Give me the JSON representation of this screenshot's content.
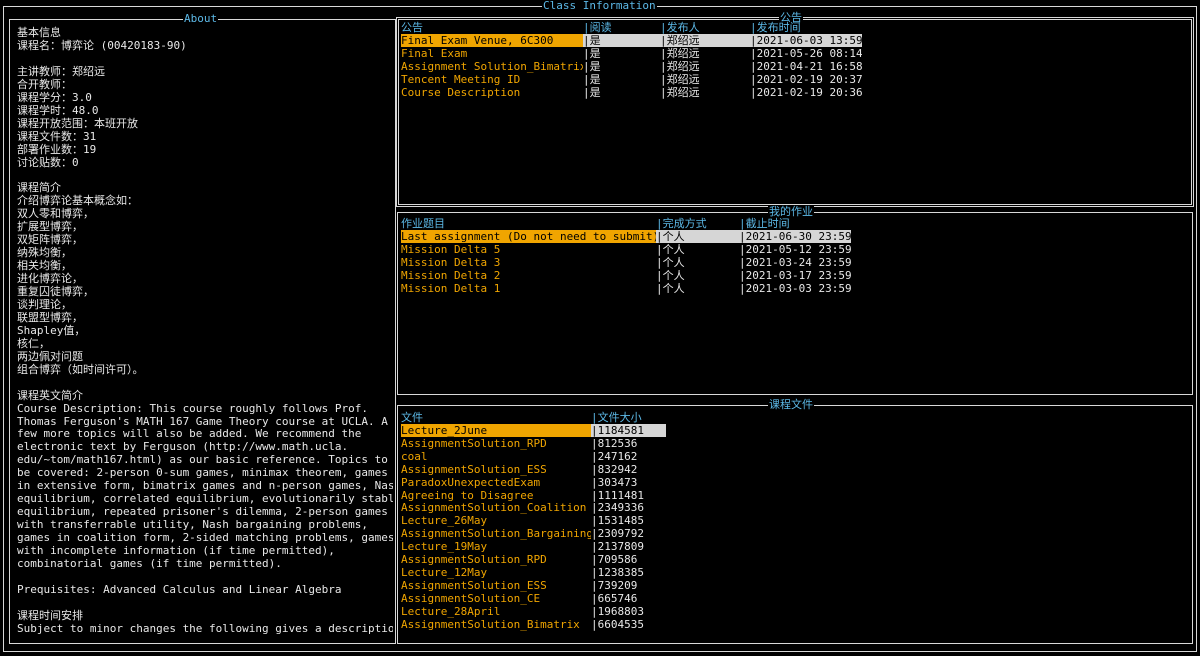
{
  "window_title": "Class Information",
  "about": {
    "title": "About",
    "lines": [
      "基本信息",
      "课程名：博弈论 (00420183-90)",
      "",
      "主讲教师：郑绍远",
      "合开教师：",
      "课程学分：3.0",
      "课程学时：48.0",
      "课程开放范围：本班开放",
      "课程文件数：31",
      "部署作业数：19",
      "讨论贴数：0",
      "",
      "课程简介",
      "介绍博弈论基本概念如：",
      "双人零和博弈，",
      "扩展型博弈，",
      "双矩阵博弈，",
      "纳殊均衡，",
      "相关均衡，",
      "进化博弈论，",
      "重复囚徒博弈，",
      "谈判理论，",
      "联盟型博弈，",
      "Shapley值，",
      "核仁，",
      "两边佩对问题",
      "组合博弈（如时间许可）。",
      "",
      "课程英文简介",
      "Course Description: This course roughly follows Prof.",
      "Thomas Ferguson's MATH 167 Game Theory course at UCLA. A",
      "few more topics will also be added. We recommend the",
      "electronic text by Ferguson (http://www.math.ucla.",
      "edu/~tom/math167.html) as our basic reference. Topics to",
      "be covered: 2-person 0-sum games, minimax theorem, games",
      "in extensive form, bimatrix games and n-person games, Nash",
      "equilibrium, correlated equilibrium, evolutionarily stable",
      "equilibrium, repeated prisoner's dilemma, 2-person games",
      "with transferrable utility, Nash bargaining problems,",
      "games in coalition form, 2-sided matching problems, games",
      "with incomplete information (if time permitted),",
      "combinatorial games (if time permitted).",
      "",
      "Prequisites: Advanced Calculus and Linear Algebra",
      "",
      "课程时间安排",
      "Subject to minor changes the following gives a description"
    ]
  },
  "announcements": {
    "title": "公告",
    "headers": [
      "公告",
      "|阅读",
      "|发布人",
      "|发布时间"
    ],
    "rows": [
      {
        "title": "Final Exam Venue, 6C300",
        "read": "|是",
        "author": "|郑绍远",
        "time": "|2021-06-03 13:59"
      },
      {
        "title": "Final Exam",
        "read": "|是",
        "author": "|郑绍远",
        "time": "|2021-05-26 08:14"
      },
      {
        "title": "Assignment Solution_Bimatrix",
        "read": "|是",
        "author": "|郑绍远",
        "time": "|2021-04-21 16:58"
      },
      {
        "title": "Tencent Meeting ID",
        "read": "|是",
        "author": "|郑绍远",
        "time": "|2021-02-19 20:37"
      },
      {
        "title": "Course Description",
        "read": "|是",
        "author": "|郑绍远",
        "time": "|2021-02-19 20:36"
      }
    ]
  },
  "homework": {
    "title": "我的作业",
    "headers": [
      "作业题目",
      "|完成方式",
      "|截止时间"
    ],
    "rows": [
      {
        "title": "Last assignment (Do not need to submit)",
        "mode": "|个人",
        "due": "|2021-06-30 23:59"
      },
      {
        "title": "Mission Delta 5",
        "mode": "|个人",
        "due": "|2021-05-12 23:59"
      },
      {
        "title": "Mission Delta 3",
        "mode": "|个人",
        "due": "|2021-03-24 23:59"
      },
      {
        "title": "Mission Delta 2",
        "mode": "|个人",
        "due": "|2021-03-17 23:59"
      },
      {
        "title": "Mission Delta 1",
        "mode": "|个人",
        "due": "|2021-03-03 23:59"
      }
    ]
  },
  "files": {
    "title": "课程文件",
    "headers": [
      "文件",
      "|文件大小"
    ],
    "rows": [
      {
        "name": "Lecture_2June",
        "size": "|1184581"
      },
      {
        "name": "AssignmentSolution_RPD",
        "size": "|812536"
      },
      {
        "name": "coal",
        "size": "|247162"
      },
      {
        "name": "AssignmentSolution_ESS",
        "size": "|832942"
      },
      {
        "name": "ParadoxUnexpectedExam",
        "size": "|303473"
      },
      {
        "name": "Agreeing to Disagree",
        "size": "|1111481"
      },
      {
        "name": "AssignmentSolution_Coalition",
        "size": "|2349336"
      },
      {
        "name": "Lecture_26May",
        "size": "|1531485"
      },
      {
        "name": "AssignmentSolution_Bargaining",
        "size": "|2309792"
      },
      {
        "name": "Lecture_19May",
        "size": "|2137809"
      },
      {
        "name": "AssignmentSolution_RPD",
        "size": "|709586"
      },
      {
        "name": "Lecture_12May",
        "size": "|1238385"
      },
      {
        "name": "AssignmentSolution_ESS",
        "size": "|739209"
      },
      {
        "name": "AssignmentSolution_CE",
        "size": "|665746"
      },
      {
        "name": "Lecture_28April",
        "size": "|1968803"
      },
      {
        "name": "AssignmentSolution_Bimatrix",
        "size": "|6604535"
      }
    ]
  },
  "colors": {
    "accent_blue": "#5cb8e6",
    "item_orange": "#f0a500",
    "selection_gray": "#d6d6d6"
  }
}
